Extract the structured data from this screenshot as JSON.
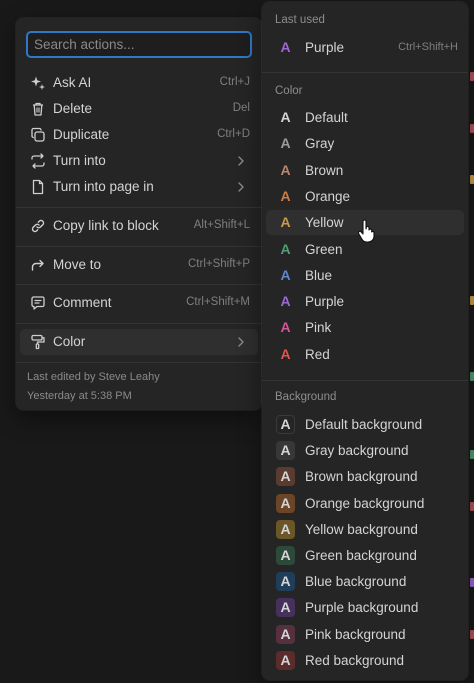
{
  "search": {
    "placeholder": "Search actions..."
  },
  "actions": [
    {
      "label": "Ask AI",
      "shortcut": "Ctrl+J",
      "icon": "sparkle-icon"
    },
    {
      "label": "Delete",
      "shortcut": "Del",
      "icon": "trash-icon"
    },
    {
      "label": "Duplicate",
      "shortcut": "Ctrl+D",
      "icon": "duplicate-icon"
    },
    {
      "label": "Turn into",
      "shortcut": "",
      "icon": "turn-into-icon"
    },
    {
      "label": "Turn into page in",
      "shortcut": "",
      "icon": "page-icon"
    },
    {
      "label": "Copy link to block",
      "shortcut": "Alt+Shift+L",
      "icon": "link-icon"
    },
    {
      "label": "Move to",
      "shortcut": "Ctrl+Shift+P",
      "icon": "move-arrow-icon"
    },
    {
      "label": "Comment",
      "shortcut": "Ctrl+Shift+M",
      "icon": "comment-icon"
    },
    {
      "label": "Color",
      "shortcut": "",
      "icon": "paint-roller-icon"
    }
  ],
  "meta": {
    "edited_by": "Last edited by Steve Leahy",
    "edited_at": "Yesterday at 5:38 PM"
  },
  "color_menu": {
    "sections": {
      "last_used": "Last used",
      "color": "Color",
      "background": "Background"
    },
    "last_used": {
      "label": "Purple",
      "shortcut": "Ctrl+Shift+H",
      "text_color": "#9d68d3"
    },
    "text_colors": [
      {
        "label": "Default",
        "text_color": "#d4d4d4"
      },
      {
        "label": "Gray",
        "text_color": "#9b9b9b"
      },
      {
        "label": "Brown",
        "text_color": "#ba856f"
      },
      {
        "label": "Orange",
        "text_color": "#c77d48"
      },
      {
        "label": "Yellow",
        "text_color": "#ca984d"
      },
      {
        "label": "Green",
        "text_color": "#529e72"
      },
      {
        "label": "Blue",
        "text_color": "#5e87c9"
      },
      {
        "label": "Purple",
        "text_color": "#9d68d3"
      },
      {
        "label": "Pink",
        "text_color": "#d15796"
      },
      {
        "label": "Red",
        "text_color": "#df5452"
      }
    ],
    "backgrounds": [
      {
        "label": "Default background",
        "bg": "#252525",
        "text_color": "#d4d4d4"
      },
      {
        "label": "Gray background",
        "bg": "#373737",
        "text_color": "#d4d4d4"
      },
      {
        "label": "Brown background",
        "bg": "#5a3b2f",
        "text_color": "#d4d4d4"
      },
      {
        "label": "Orange background",
        "bg": "#6b4526",
        "text_color": "#d4d4d4"
      },
      {
        "label": "Yellow background",
        "bg": "#6b5627",
        "text_color": "#d4d4d4"
      },
      {
        "label": "Green background",
        "bg": "#2b4a3a",
        "text_color": "#d4d4d4"
      },
      {
        "label": "Blue background",
        "bg": "#1f3e59",
        "text_color": "#d4d4d4"
      },
      {
        "label": "Purple background",
        "bg": "#47305c",
        "text_color": "#d4d4d4"
      },
      {
        "label": "Pink background",
        "bg": "#56303f",
        "text_color": "#d4d4d4"
      },
      {
        "label": "Red background",
        "bg": "#5c2b2b",
        "text_color": "#d4d4d4"
      }
    ]
  },
  "colors": {
    "accent": "#2e78c7",
    "menu_bg": "#252525",
    "page_bg": "#191919"
  }
}
